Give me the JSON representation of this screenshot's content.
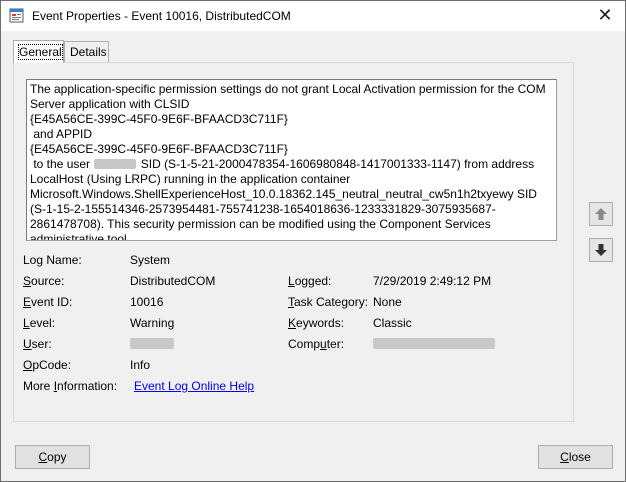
{
  "window": {
    "title": "Event Properties - Event 10016, DistributedCOM",
    "close_glyph": "✕"
  },
  "tabs": [
    {
      "label": "General",
      "active": true
    },
    {
      "label": "Details",
      "active": false
    }
  ],
  "description": {
    "part1": "The application-specific permission settings do not grant Local Activation permission for the COM Server application with CLSID\n{E45A56CE-399C-45F0-9E6F-BFAACD3C711F}\n and APPID\n{E45A56CE-399C-45F0-9E6F-BFAACD3C711F}\n to the user ",
    "part2": " SID (S-1-5-21-2000478354-1606980848-1417001333-1147) from address LocalHost (Using LRPC) running in the application container Microsoft.Windows.ShellExperienceHost_10.0.18362.145_neutral_neutral_cw5n1h2txyewy SID (S-1-15-2-155514346-2573954481-755741238-1654018636-1233331829-3075935687-2861478708). This security permission can be modified using the Component Services administrative tool."
  },
  "fields": {
    "log_name": {
      "label_pre": "Log Name:",
      "value": "System"
    },
    "source": {
      "label_pre": "",
      "label_u": "S",
      "label_post": "ource:",
      "value": "DistributedCOM"
    },
    "logged": {
      "label_u": "L",
      "label_post": "ogged:",
      "value": "7/29/2019 2:49:12 PM"
    },
    "event_id": {
      "label_u": "E",
      "label_post": "vent ID:",
      "value": "10016"
    },
    "task_category": {
      "label_u": "T",
      "label_post": "ask Category:",
      "value": "None"
    },
    "level": {
      "label_u": "L",
      "label_post": "evel:",
      "value": "Warning"
    },
    "keywords": {
      "label_u": "K",
      "label_post": "eywords:",
      "value": "Classic"
    },
    "user": {
      "label_u": "U",
      "label_post": "ser:"
    },
    "computer": {
      "label_pre": "Comp",
      "label_u": "u",
      "label_post": "ter:"
    },
    "opcode": {
      "label_u": "O",
      "label_post": "pCode:",
      "value": "Info"
    },
    "more_info": {
      "label_pre": "More ",
      "label_u": "I",
      "label_post": "nformation:",
      "link": "Event Log Online Help"
    }
  },
  "buttons": {
    "copy": {
      "label_u": "C",
      "label_post": "opy"
    },
    "close": {
      "label_u": "C",
      "label_post": "lose"
    }
  },
  "icons": {
    "up": "arrow-up-icon",
    "down": "arrow-down-icon"
  }
}
